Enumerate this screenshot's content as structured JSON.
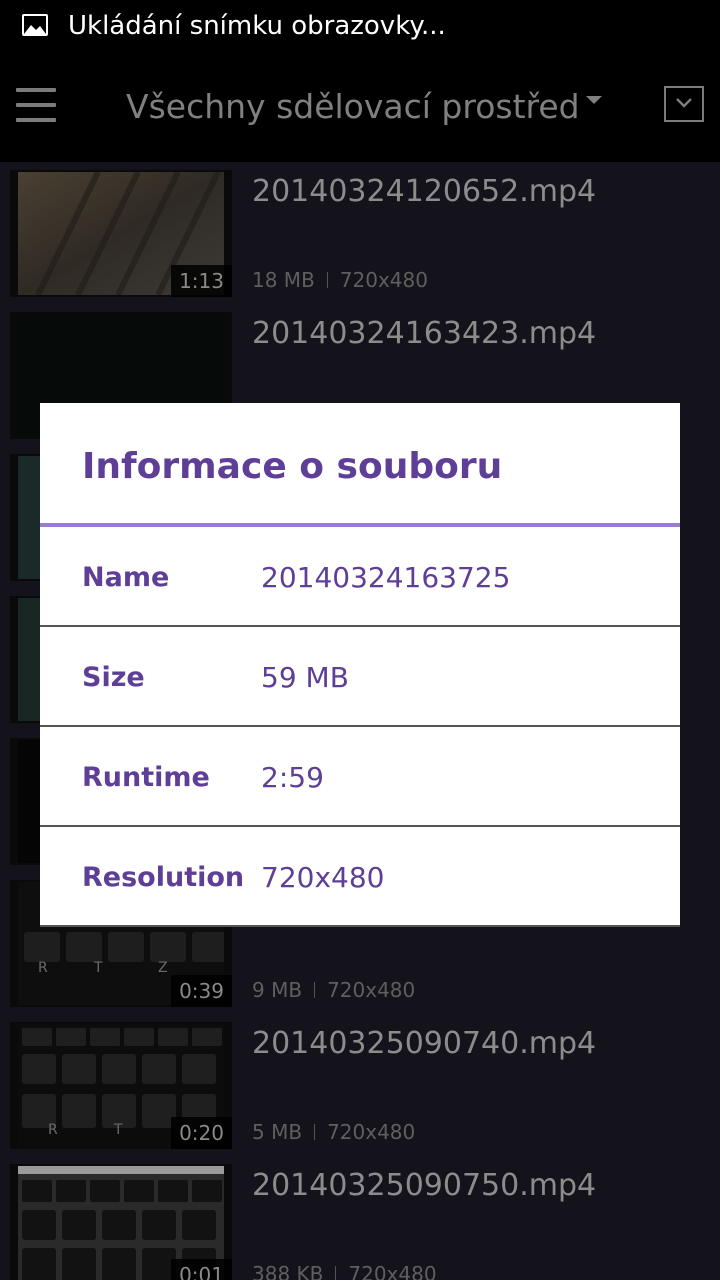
{
  "status_bar": {
    "icon": "image-icon",
    "text": "Ukládání snímku obrazovky..."
  },
  "app_bar": {
    "menu_icon": "hamburger-menu-icon",
    "title": "Všechny sdělovací prostřed",
    "dropdown_icon": "caret-down-icon",
    "overflow_icon": "chevron-down-box-icon"
  },
  "videos": [
    {
      "filename": "20140324120652.mp4",
      "duration": "1:13",
      "size": "18 MB",
      "resolution": "720x480"
    },
    {
      "filename": "20140324163423.mp4",
      "duration": "",
      "size": "",
      "resolution": ""
    },
    {
      "filename": "",
      "duration": "0:39",
      "size": "9 MB",
      "resolution": "720x480"
    },
    {
      "filename": "20140325090740.mp4",
      "duration": "0:20",
      "size": "5 MB",
      "resolution": "720x480"
    },
    {
      "filename": "20140325090750.mp4",
      "duration": "0:01",
      "size": "388 KB",
      "resolution": "720x480"
    }
  ],
  "dialog": {
    "title": "Informace o souboru",
    "rows": [
      {
        "label": "Name",
        "value": "20140324163725"
      },
      {
        "label": "Size",
        "value": "59 MB"
      },
      {
        "label": "Runtime",
        "value": "2:59"
      },
      {
        "label": "Resolution",
        "value": "720x480"
      }
    ]
  },
  "colors": {
    "dialog_accent": "#5e3e96",
    "dialog_divider": "#9b7ad6",
    "list_background": "#14121a"
  }
}
